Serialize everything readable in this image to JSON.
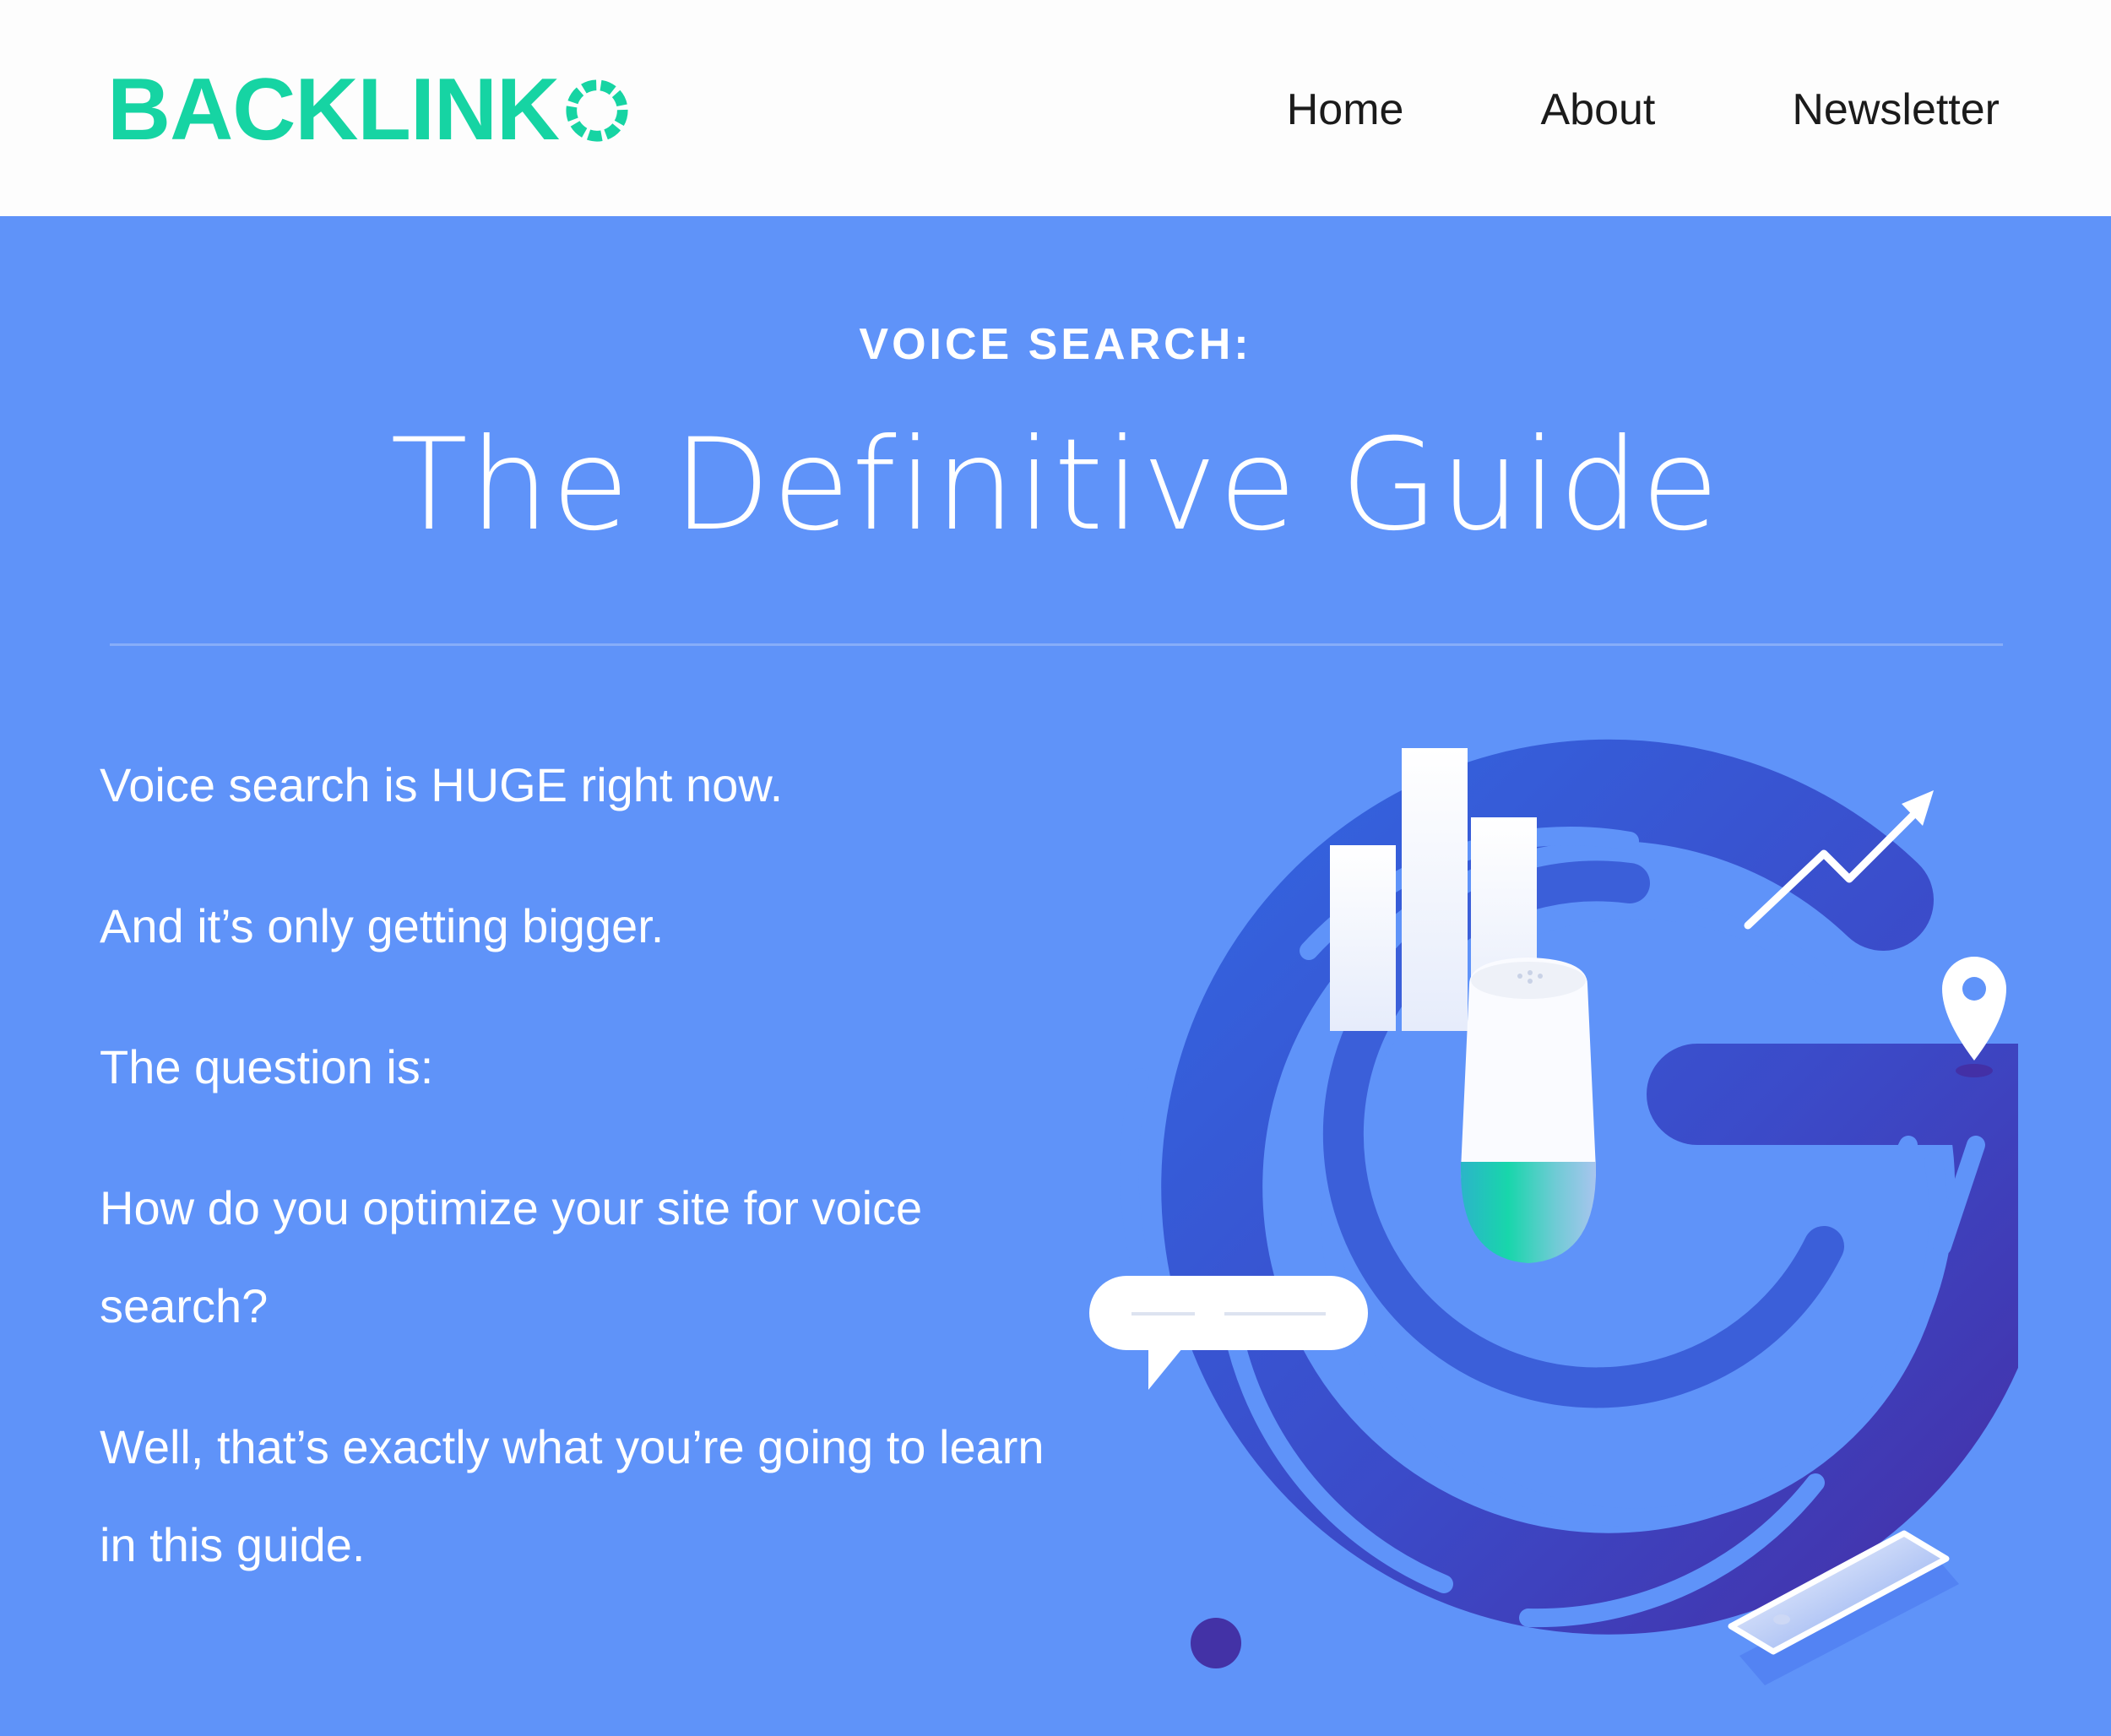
{
  "header": {
    "logo_text": "BACKLINK",
    "logo_full": "BACKLINKO",
    "brand_color": "#16d4a3",
    "nav": [
      {
        "label": "Home"
      },
      {
        "label": "About"
      },
      {
        "label": "Newsletter"
      }
    ]
  },
  "hero": {
    "background": "#5f93f9",
    "kicker": "VOICE SEARCH:",
    "title": "The Definitive Guide",
    "paragraphs": [
      "Voice search is HUGE right now.",
      "And it’s only getting bigger.",
      "The question is:",
      "How do you optimize your site for voice search?",
      "Well, that’s exactly what you’re going to learn in this guide."
    ]
  },
  "illustration": {
    "icons": [
      "bar-chart-icon",
      "trend-arrow-icon",
      "smart-speaker-icon",
      "location-pin-icon",
      "chat-bubble-icon",
      "smartphone-icon"
    ]
  }
}
